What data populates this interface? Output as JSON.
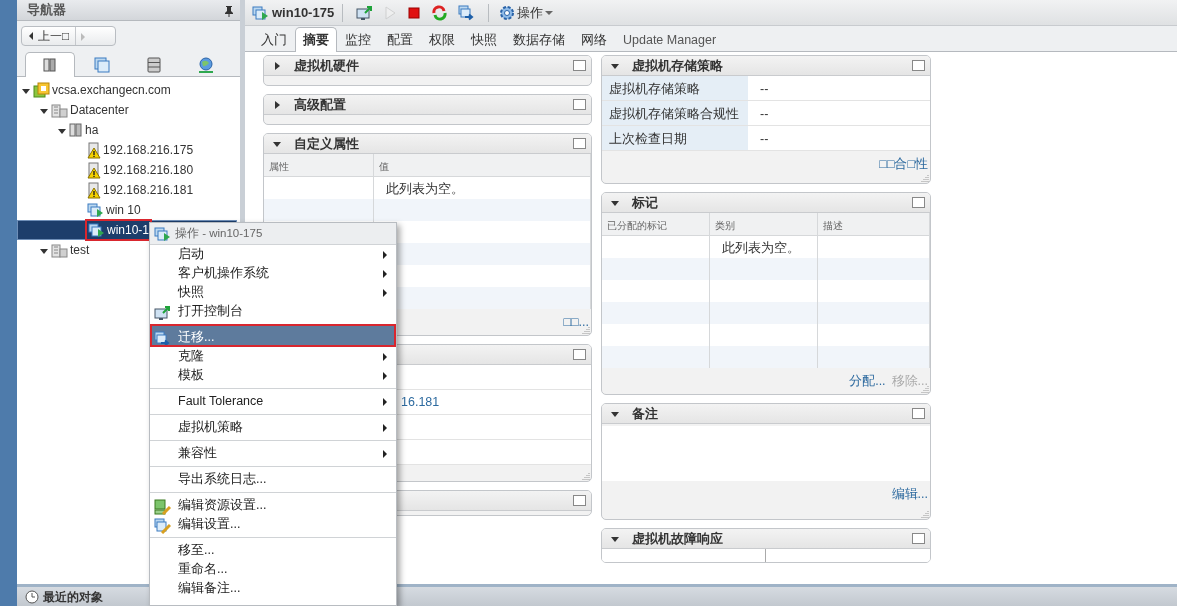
{
  "navigator": {
    "title": "导航器",
    "back_button": "上一□",
    "tabs": [
      {
        "kind": "hosts",
        "selected": true
      },
      {
        "kind": "vms",
        "selected": false
      },
      {
        "kind": "storage",
        "selected": false
      },
      {
        "kind": "network",
        "selected": false
      }
    ],
    "tree": [
      {
        "label": "vcsa.exchangecn.com",
        "kind": "vcenter",
        "expanded": true,
        "selected": false,
        "children": [
          {
            "label": "Datacenter",
            "kind": "datacenter",
            "expanded": true,
            "selected": false,
            "children": [
              {
                "label": "ha",
                "kind": "cluster",
                "expanded": true,
                "selected": false,
                "children": [
                  {
                    "label": "192.168.216.175",
                    "kind": "host-warning",
                    "selected": false
                  },
                  {
                    "label": "192.168.216.180",
                    "kind": "host-warning",
                    "selected": false
                  },
                  {
                    "label": "192.168.216.181",
                    "kind": "host-warning",
                    "selected": false
                  },
                  {
                    "label": "win 10",
                    "kind": "vm",
                    "selected": false
                  },
                  {
                    "label": "win10-1",
                    "kind": "vm",
                    "selected": true,
                    "highlighted": true
                  }
                ]
              }
            ]
          },
          {
            "label": "test",
            "kind": "datacenter",
            "expanded": true,
            "selected": false
          }
        ]
      }
    ],
    "recent_objects": "最近的对象"
  },
  "toolbar": {
    "vm_name": "win10-175",
    "buttons": [
      {
        "kind": "console",
        "disabled": false
      },
      {
        "kind": "power-on",
        "disabled": true
      },
      {
        "kind": "stop",
        "disabled": false
      },
      {
        "kind": "restart",
        "disabled": false
      },
      {
        "kind": "migrate",
        "disabled": false
      }
    ],
    "actions": "操作"
  },
  "tabs": [
    {
      "label": "入门",
      "selected": false
    },
    {
      "label": "摘要",
      "selected": true
    },
    {
      "label": "监控",
      "selected": false
    },
    {
      "label": "配置",
      "selected": false
    },
    {
      "label": "权限",
      "selected": false
    },
    {
      "label": "快照",
      "selected": false
    },
    {
      "label": "数据存储",
      "selected": false
    },
    {
      "label": "网络",
      "selected": false
    },
    {
      "label": "Update Manager",
      "selected": false
    }
  ],
  "left_panels": [
    {
      "kind": "collapsed",
      "title": "虚拟机硬件",
      "expanded": false
    },
    {
      "kind": "collapsed",
      "title": "高级配置",
      "expanded": false
    },
    {
      "kind": "table",
      "title": "自定义属性",
      "expanded": true,
      "columns": [
        {
          "label": "属性"
        },
        {
          "label": "值",
          "empty_text": "此列表为空。"
        }
      ],
      "links": [
        {
          "label": "□□...",
          "disabled": false
        }
      ]
    },
    {
      "kind": "list",
      "link_text": "16.181"
    },
    {
      "kind": "header"
    }
  ],
  "right_panels": [
    {
      "kind": "properties",
      "title": "虚拟机存储策略",
      "expanded": true,
      "rows": [
        {
          "key": "虚拟机存储策略",
          "value": "--"
        },
        {
          "key": "虚拟机存储策略合规性",
          "value": "--"
        },
        {
          "key": "上次检查日期",
          "value": "--"
        }
      ],
      "links": [
        {
          "label": "□□合□性",
          "disabled": false
        }
      ]
    },
    {
      "kind": "table",
      "title": "标记",
      "expanded": true,
      "columns": [
        {
          "label": "已分配的标记"
        },
        {
          "label": "类别",
          "empty_text": "此列表为空。"
        },
        {
          "label": "描述"
        }
      ],
      "links": [
        {
          "label": "分配...",
          "disabled": false
        },
        {
          "label": "移除...",
          "disabled": true
        }
      ]
    },
    {
      "kind": "notes",
      "title": "备注",
      "expanded": true,
      "links": [
        {
          "label": "编辑...",
          "disabled": false
        }
      ]
    },
    {
      "kind": "cut",
      "title": "虚拟机故障响应",
      "expanded": true
    }
  ],
  "context_menu": {
    "title": "操作 - win10-175",
    "items": [
      {
        "label": "启动",
        "submenu": true,
        "separator_before": false,
        "selected": false
      },
      {
        "label": "客户机操作系统",
        "submenu": true,
        "separator_before": false,
        "selected": false
      },
      {
        "label": "快照",
        "submenu": true,
        "separator_before": false,
        "selected": false
      },
      {
        "label": "打开控制台",
        "submenu": false,
        "kind": "console",
        "separator_before": false,
        "selected": false
      },
      {
        "label": "迁移...",
        "submenu": false,
        "kind": "migrate",
        "separator_before": true,
        "selected": true,
        "highlighted": true
      },
      {
        "label": "克隆",
        "submenu": true,
        "separator_before": false,
        "selected": false
      },
      {
        "label": "模板",
        "submenu": true,
        "separator_before": false,
        "selected": false
      },
      {
        "label": "Fault Tolerance",
        "submenu": true,
        "separator_before": true,
        "selected": false
      },
      {
        "label": "虚拟机策略",
        "submenu": true,
        "separator_before": true,
        "selected": false
      },
      {
        "label": "兼容性",
        "submenu": true,
        "separator_before": true,
        "selected": false
      },
      {
        "label": "导出系统日志...",
        "submenu": false,
        "separator_before": true,
        "selected": false
      },
      {
        "label": "编辑资源设置...",
        "submenu": false,
        "kind": "edit-resources",
        "separator_before": true,
        "selected": false
      },
      {
        "label": "编辑设置...",
        "submenu": false,
        "kind": "edit-settings",
        "separator_before": false,
        "selected": false
      },
      {
        "label": "移至...",
        "submenu": false,
        "separator_before": true,
        "selected": false
      },
      {
        "label": "重命名...",
        "submenu": false,
        "separator_before": false,
        "selected": false
      },
      {
        "label": "编辑备注...",
        "submenu": false,
        "separator_before": false,
        "selected": false
      }
    ]
  }
}
